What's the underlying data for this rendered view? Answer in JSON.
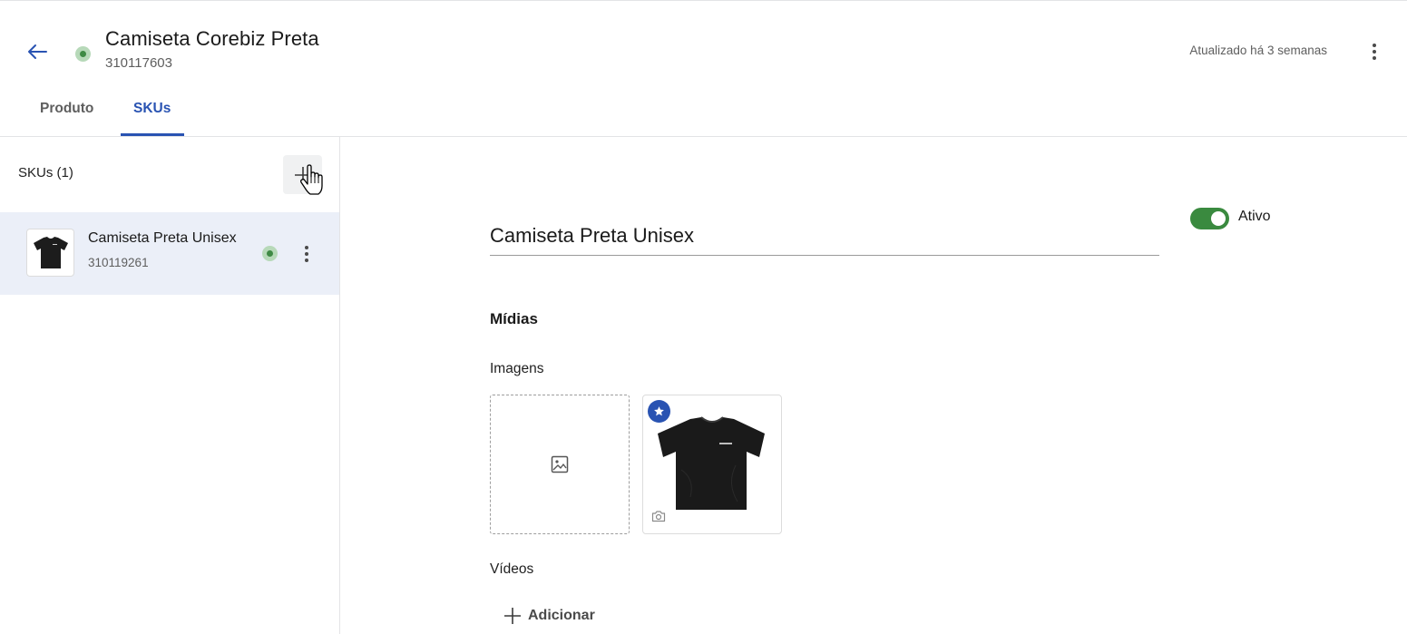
{
  "header": {
    "title": "Camiseta Corebiz Preta",
    "product_id": "310117603",
    "updated": "Atualizado há 3 semanas",
    "status_color": "#3f8a45"
  },
  "tabs": [
    {
      "label": "Produto",
      "active": false
    },
    {
      "label": "SKUs",
      "active": true
    }
  ],
  "sidebar": {
    "count_label": "SKUs (1)",
    "items": [
      {
        "name": "Camiseta Preta Unisex",
        "code": "310119261",
        "active": true
      }
    ]
  },
  "main": {
    "sku_name": "Camiseta Preta Unisex",
    "toggle": {
      "label": "Ativo",
      "on": true
    },
    "media_title": "Mídias",
    "images_label": "Imagens",
    "videos_label": "Vídeos",
    "add_label": "Adicionar"
  },
  "colors": {
    "accent": "#2953b2",
    "active_green": "#3a8a3f",
    "selected_row": "#ebeff8"
  },
  "icons": [
    "arrow-left-icon",
    "kebab-icon",
    "plus-icon",
    "image-placeholder-icon",
    "star-icon",
    "camera-icon",
    "hand-cursor-icon"
  ]
}
